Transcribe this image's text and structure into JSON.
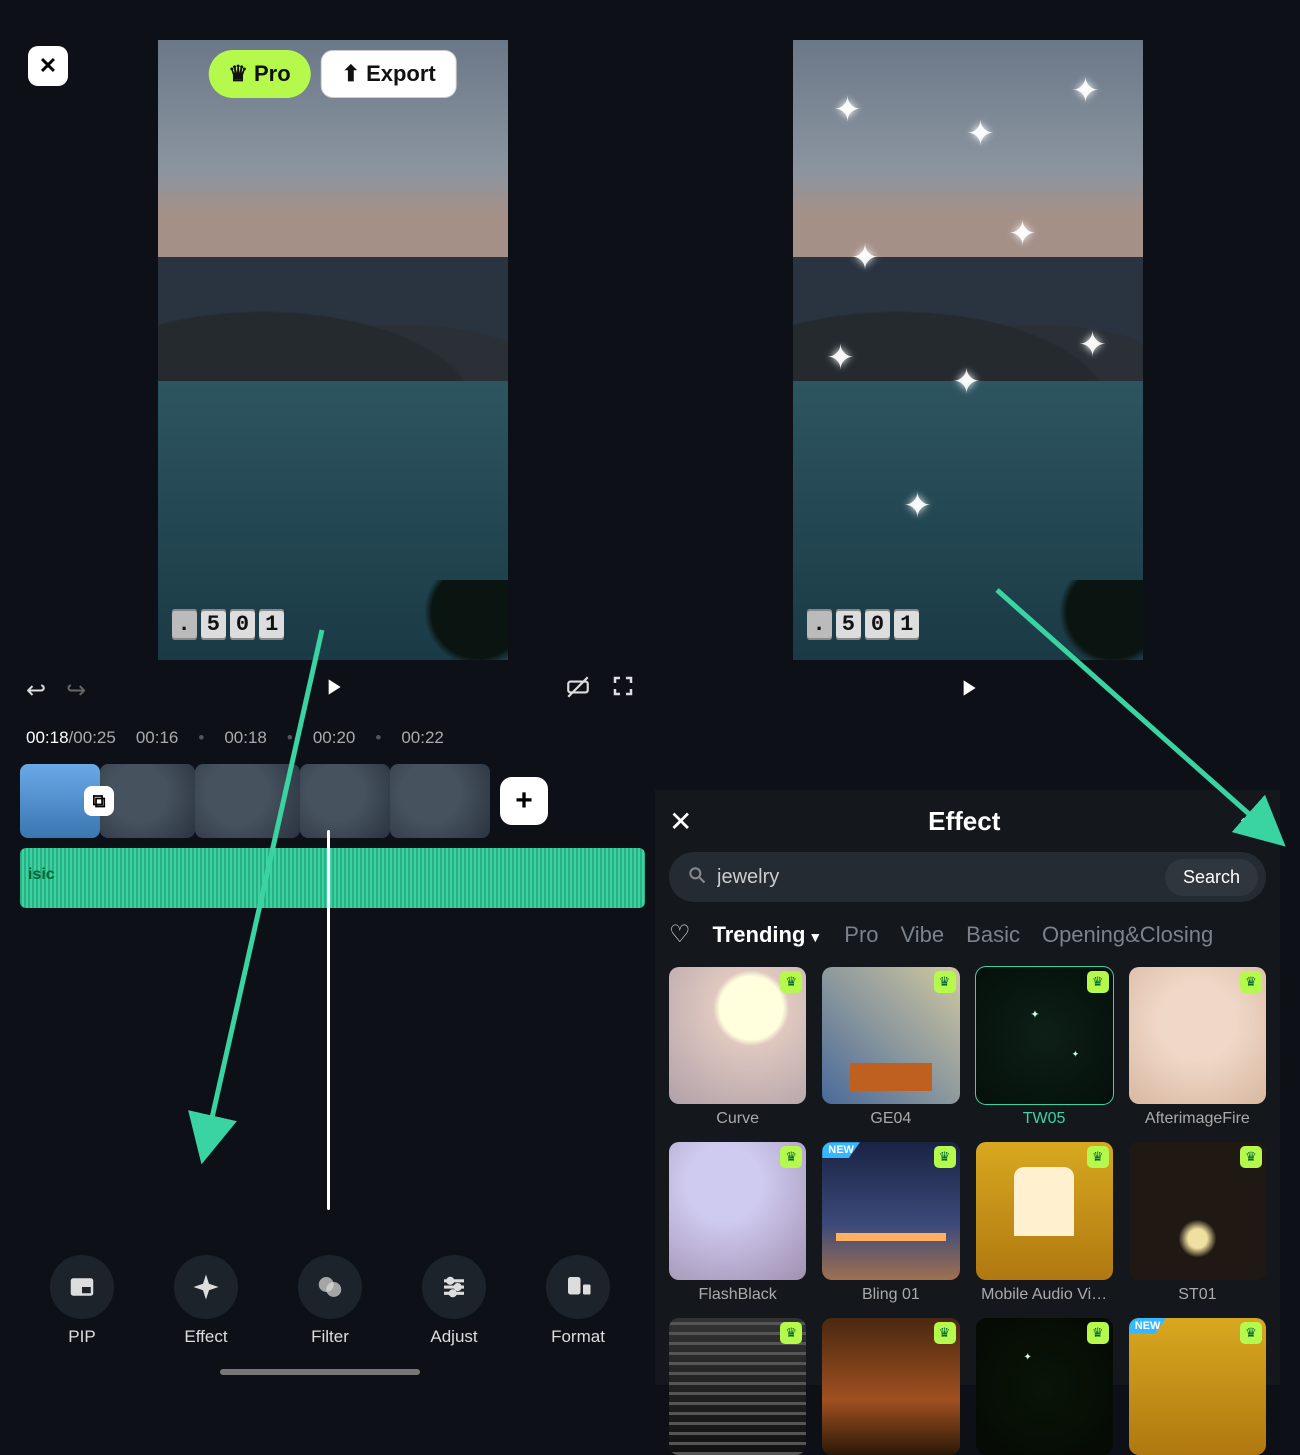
{
  "header": {
    "pro_label": "Pro",
    "export_label": "Export"
  },
  "preview": {
    "counter": [
      ".",
      "5",
      "0",
      "1"
    ]
  },
  "timeline": {
    "current": "00:18",
    "duration": "00:25",
    "marks": [
      "00:16",
      "00:18",
      "00:20",
      "00:22"
    ],
    "audio_label": "isic"
  },
  "tools": [
    {
      "id": "pip",
      "label": "PIP"
    },
    {
      "id": "effect",
      "label": "Effect"
    },
    {
      "id": "filter",
      "label": "Filter"
    },
    {
      "id": "adjust",
      "label": "Adjust"
    },
    {
      "id": "format",
      "label": "Format"
    }
  ],
  "effectPanel": {
    "title": "Effect",
    "search_value": "jewelry",
    "search_button": "Search",
    "tabs": [
      "Trending",
      "Pro",
      "Vibe",
      "Basic",
      "Opening&Closing"
    ],
    "active_tab": "Trending",
    "items": [
      {
        "label": "Curve",
        "pro": true,
        "new": false,
        "selected": false,
        "thumbClass": "th-curve"
      },
      {
        "label": "GE04",
        "pro": true,
        "new": false,
        "selected": false,
        "thumbClass": "th-ge04"
      },
      {
        "label": "TW05",
        "pro": true,
        "new": false,
        "selected": true,
        "thumbClass": "th-tw05"
      },
      {
        "label": "AfterimageFire",
        "pro": true,
        "new": false,
        "selected": false,
        "thumbClass": "th-after"
      },
      {
        "label": "FlashBlack",
        "pro": true,
        "new": false,
        "selected": false,
        "thumbClass": "th-flash"
      },
      {
        "label": "Bling 01",
        "pro": true,
        "new": true,
        "selected": false,
        "thumbClass": "th-bling"
      },
      {
        "label": "Mobile Audio Vi…",
        "pro": true,
        "new": false,
        "selected": false,
        "thumbClass": "th-mob"
      },
      {
        "label": "ST01",
        "pro": true,
        "new": false,
        "selected": false,
        "thumbClass": "th-st01"
      },
      {
        "label": "",
        "pro": true,
        "new": false,
        "selected": false,
        "thumbClass": "th-r3a"
      },
      {
        "label": "",
        "pro": true,
        "new": false,
        "selected": false,
        "thumbClass": "th-r3b"
      },
      {
        "label": "",
        "pro": true,
        "new": false,
        "selected": false,
        "thumbClass": "th-r3c"
      },
      {
        "label": "",
        "pro": true,
        "new": true,
        "selected": false,
        "thumbClass": "th-r3d"
      }
    ]
  }
}
